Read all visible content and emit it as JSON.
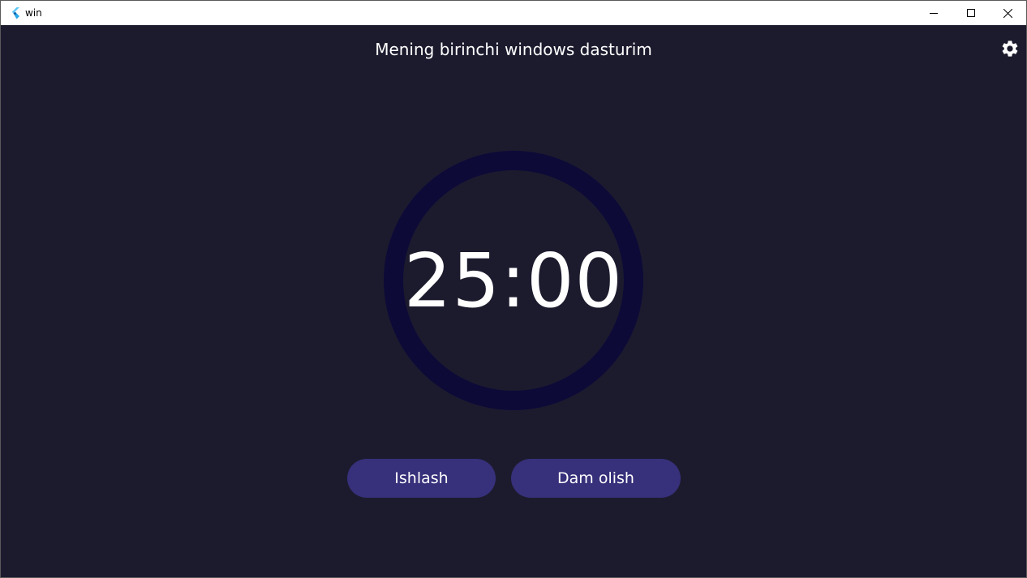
{
  "window": {
    "title": "win",
    "controls": {
      "minimize": "minimize-icon",
      "maximize": "maximize-icon",
      "close": "close-icon"
    }
  },
  "app": {
    "heading": "Mening birinchi windows dasturim",
    "settings_icon": "gear-icon"
  },
  "timer": {
    "display": "25:00",
    "progress": 0
  },
  "modes": {
    "work_label": "Ishlash",
    "rest_label": "Dam olish"
  },
  "colors": {
    "background": "#1c1b2e",
    "ring": "#0d0a38",
    "button": "#37307a",
    "text": "#ffffff"
  }
}
